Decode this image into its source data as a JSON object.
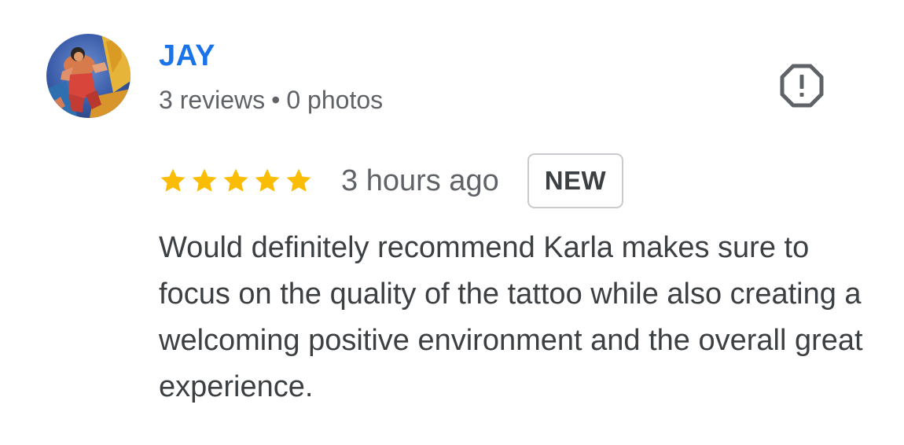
{
  "review": {
    "author": {
      "name": "JAY",
      "reviews_count": "3 reviews",
      "separator": "•",
      "photos_count": "0 photos",
      "avatar_icon": "profile-photo"
    },
    "report_icon": "report-flag-octagon-icon",
    "rating": {
      "value": 5,
      "max": 5,
      "star_color": "#fbbc04"
    },
    "time_ago": "3 hours ago",
    "badge": "NEW",
    "text": "Would definitely recommend Karla makes sure to focus on the quality of the tattoo while also creating a welcoming positive environment and the overall great experience.",
    "colors": {
      "author_name": "#1a73e8",
      "meta_text": "#5f6368",
      "body_text": "#3c4043"
    }
  }
}
